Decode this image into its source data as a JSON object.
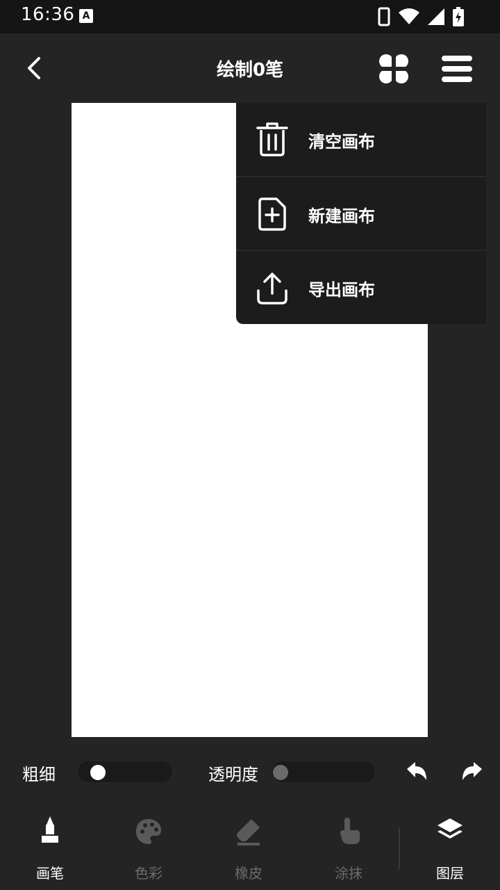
{
  "status_bar": {
    "time": "16:36",
    "notification_icon": "A"
  },
  "app_bar": {
    "title": "绘制0笔"
  },
  "dropdown_menu": {
    "items": [
      {
        "label": "清空画布",
        "icon": "trash-icon"
      },
      {
        "label": "新建画布",
        "icon": "new-file-icon"
      },
      {
        "label": "导出画布",
        "icon": "export-icon"
      }
    ]
  },
  "controls": {
    "thickness_label": "粗细",
    "opacity_label": "透明度",
    "thickness_value": 0.15,
    "opacity_value": 0.0
  },
  "bottom_nav": {
    "items": [
      {
        "label": "画笔",
        "icon": "brush-icon",
        "active": true
      },
      {
        "label": "色彩",
        "icon": "palette-icon",
        "active": false
      },
      {
        "label": "橡皮",
        "icon": "eraser-icon",
        "active": false
      },
      {
        "label": "涂抹",
        "icon": "smudge-icon",
        "active": false
      },
      {
        "label": "图层",
        "icon": "layers-icon",
        "active": true
      }
    ]
  },
  "colors": {
    "background": "#242424",
    "status_bar": "#151515",
    "menu_bg": "#1c1c1c",
    "active": "#ffffff",
    "inactive": "#6b6b6b"
  }
}
